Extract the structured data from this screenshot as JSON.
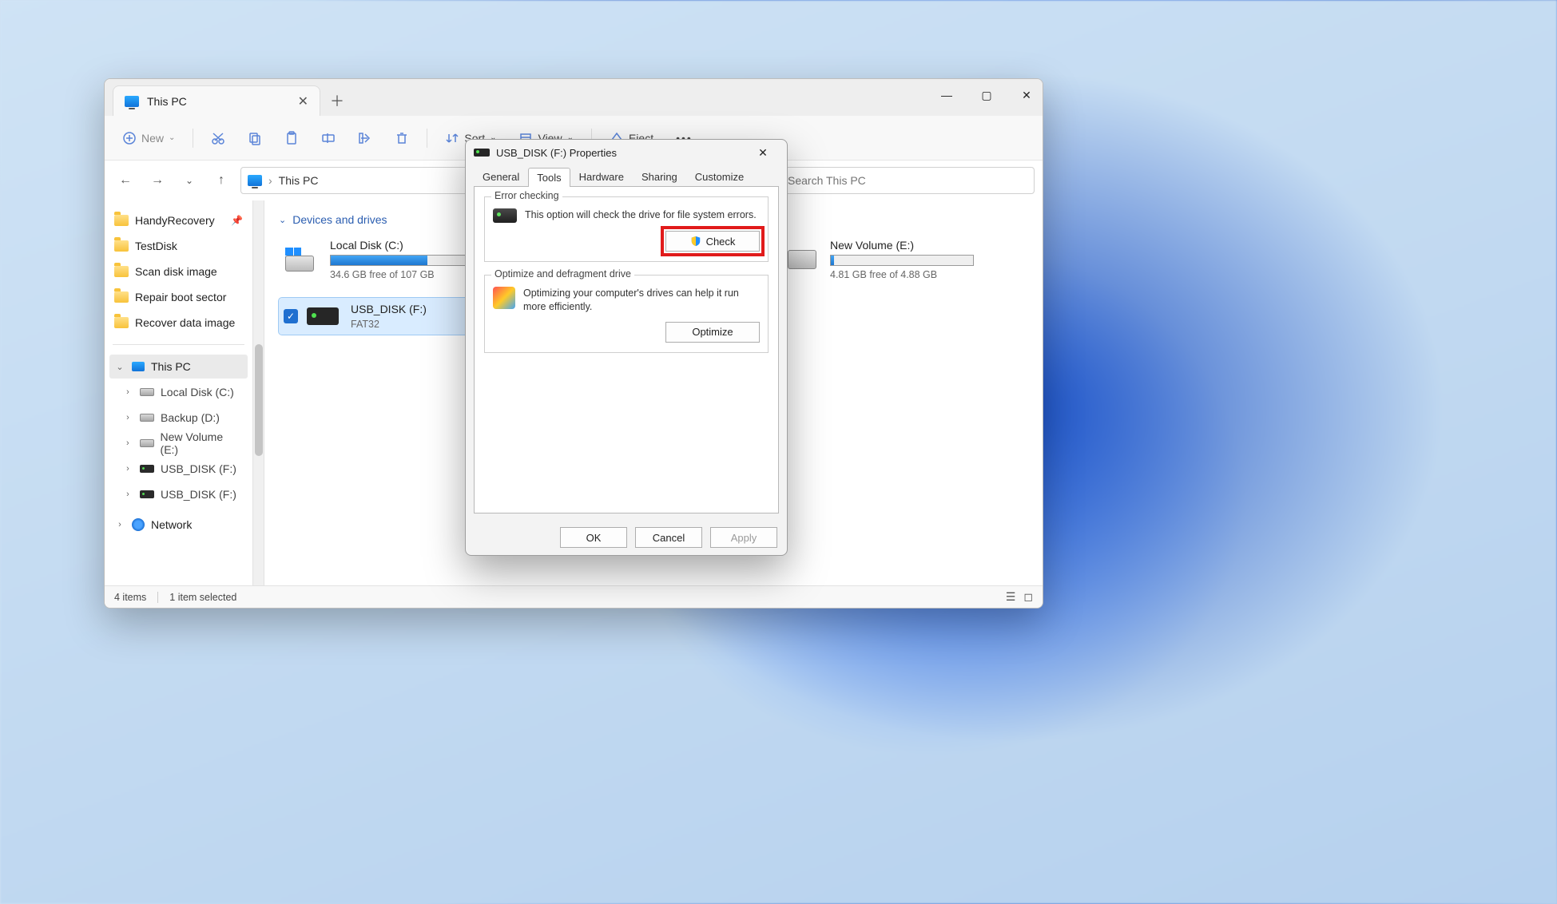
{
  "explorer": {
    "tab_title": "This PC",
    "toolbar": {
      "new": "New",
      "sort": "Sort",
      "view": "View",
      "eject": "Eject"
    },
    "addressbar": {
      "crumb_root": "This PC"
    },
    "search_placeholder": "Search This PC",
    "nav": {
      "quick": [
        "HandyRecovery",
        "TestDisk",
        "Scan disk image",
        "Repair boot sector",
        "Recover data image"
      ],
      "this_pc": "This PC",
      "drives": [
        "Local Disk (C:)",
        "Backup (D:)",
        "New Volume (E:)",
        "USB_DISK (F:)",
        "USB_DISK (F:)"
      ],
      "network": "Network"
    },
    "group_header": "Devices and drives",
    "drives": [
      {
        "name": "Local Disk (C:)",
        "info": "34.6 GB free of 107 GB",
        "fill": 68,
        "type": "os"
      },
      {
        "name": "New Volume (E:)",
        "info": "4.81 GB free of 4.88 GB",
        "fill": 2,
        "type": "hdd"
      },
      {
        "name": "USB_DISK (F:)",
        "info": "FAT32",
        "fill": null,
        "type": "usb",
        "selected": true
      }
    ],
    "status": {
      "items": "4 items",
      "selection": "1 item selected"
    }
  },
  "dialog": {
    "title": "USB_DISK (F:) Properties",
    "tabs": [
      "General",
      "Tools",
      "Hardware",
      "Sharing",
      "Customize"
    ],
    "active_tab": "Tools",
    "error_check": {
      "title": "Error checking",
      "text": "This option will check the drive for file system errors.",
      "button": "Check"
    },
    "optimize": {
      "title": "Optimize and defragment drive",
      "text": "Optimizing your computer's drives can help it run more efficiently.",
      "button": "Optimize"
    },
    "footer": {
      "ok": "OK",
      "cancel": "Cancel",
      "apply": "Apply"
    }
  }
}
